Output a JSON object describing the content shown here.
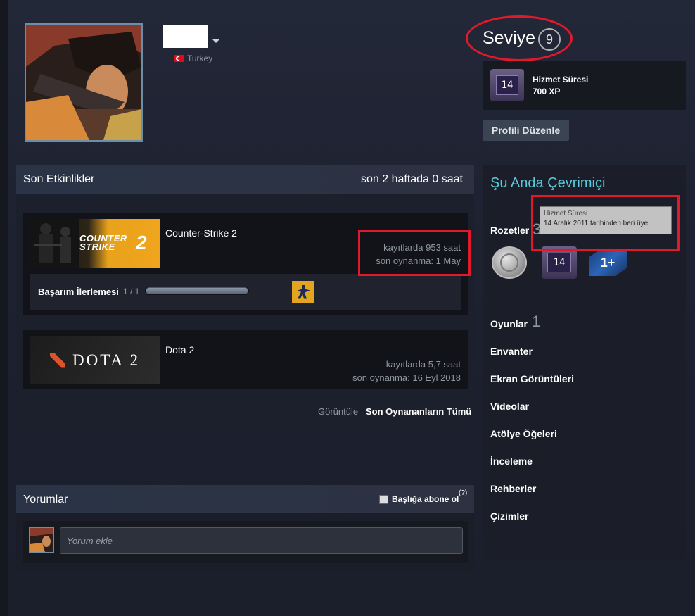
{
  "profile": {
    "country": "Turkey"
  },
  "level": {
    "label": "Seviye",
    "value": "9"
  },
  "xp": {
    "badge_number": "14",
    "title": "Hizmet Süresi",
    "value": "700 XP"
  },
  "edit_profile_label": "Profili Düzenle",
  "recent_activity": {
    "title": "Son Etkinlikler",
    "hours_summary": "son 2 haftada 0 saat",
    "games": [
      {
        "name": "Counter-Strike 2",
        "capsule_text": "COUNTER STRIKE",
        "capsule_number": "2",
        "hours": "kayıtlarda 953 saat",
        "last_played": "son oynanma: 1 May"
      },
      {
        "name": "Dota 2",
        "capsule_text": "DOTA 2",
        "hours": "kayıtlarda 5,7 saat",
        "last_played": "son oynanma: 16 Eyl 2018"
      }
    ],
    "achievement": {
      "label": "Başarım İlerlemesi",
      "count": "1 / 1",
      "progress": 1.0
    },
    "view_label": "Görüntüle",
    "view_all_link": "Son Oynananların Tümü"
  },
  "comments": {
    "title": "Yorumlar",
    "subscribe_label": "Başlığa abone ol",
    "help_mark": "(?)",
    "input_placeholder": "Yorum ekle"
  },
  "sidebar": {
    "online_status": "Şu Anda Çevrimiçi",
    "badges_label": "Rozetler",
    "badges_count": "3",
    "badge_years_number": "14",
    "badge_plus_text": "1+",
    "tooltip_title": "Hizmet Süresi",
    "tooltip_text": "14 Aralık 2011 tarihinden beri üye.",
    "games_label": "Oyunlar",
    "games_count": "1",
    "links": [
      "Envanter",
      "Ekran Görüntüleri",
      "Videolar",
      "Atölye Öğeleri",
      "İnceleme",
      "Rehberler",
      "Çizimler"
    ]
  },
  "colors": {
    "online": "#57cbde",
    "annotation_red": "#e2192a",
    "cs_orange": "#f0a51d",
    "dota_red": "#e0522c"
  }
}
